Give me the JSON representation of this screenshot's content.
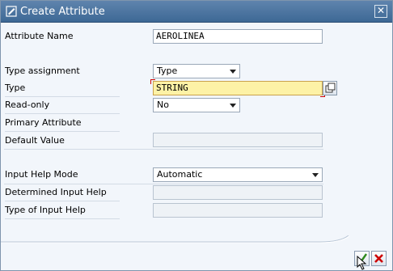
{
  "window": {
    "title": "Create Attribute",
    "close_label": "✕"
  },
  "form": {
    "attribute_name": {
      "label": "Attribute Name",
      "value": "AEROLINEA"
    },
    "type_assignment": {
      "label": "Type assignment",
      "value": "Type"
    },
    "type": {
      "label": "Type",
      "value": "STRING"
    },
    "read_only": {
      "label": "Read-only",
      "value": "No"
    },
    "primary_attribute": {
      "label": "Primary Attribute"
    },
    "default_value": {
      "label": "Default Value",
      "value": ""
    },
    "input_help_mode": {
      "label": "Input Help Mode",
      "value": "Automatic"
    },
    "determined_input_help": {
      "label": "Determined Input Help",
      "value": ""
    },
    "type_of_input_help": {
      "label": "Type of Input Help",
      "value": ""
    }
  },
  "buttons": {
    "ok_icon": "checkmark-icon",
    "cancel_icon": "x-icon"
  },
  "colors": {
    "title_bar": "#4a73a0",
    "required_field": "#fdf2a6",
    "cancel_red": "#cc0000",
    "ok_green": "#2f8a1e"
  }
}
